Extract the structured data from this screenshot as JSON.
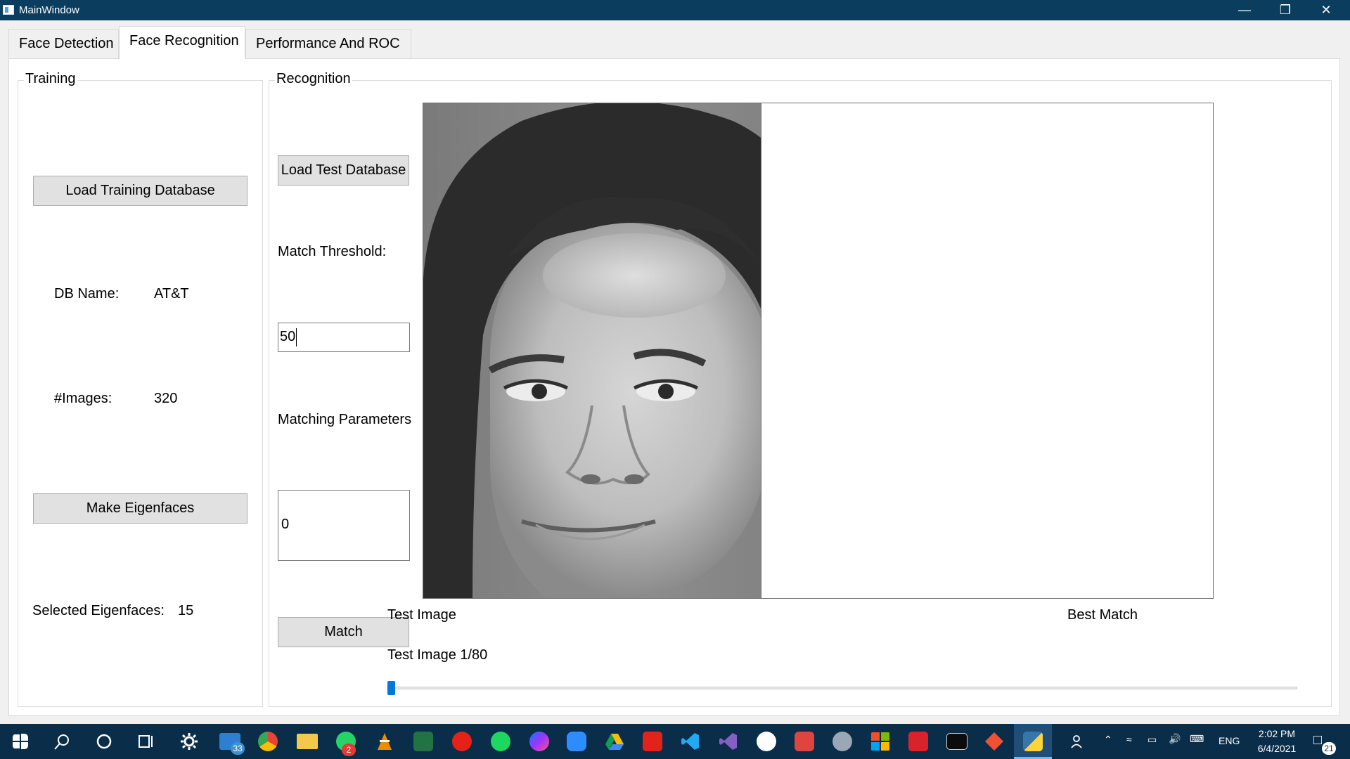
{
  "window": {
    "title": "MainWindow"
  },
  "tabs": [
    {
      "label": "Face Detection"
    },
    {
      "label": "Face Recognition"
    },
    {
      "label": "Performance And ROC"
    }
  ],
  "training": {
    "group_title": "Training",
    "load_button": "Load Training Database",
    "db_name_label": "DB Name:",
    "db_name_value": "AT&T",
    "images_label": "#Images:",
    "images_value": "320",
    "make_eigenfaces_button": "Make Eigenfaces",
    "selected_eigenfaces_label": "Selected Eigenfaces:",
    "selected_eigenfaces_value": "15"
  },
  "recognition": {
    "group_title": "Recognition",
    "load_test_button": "Load Test Database",
    "threshold_label": "Match Threshold:",
    "threshold_value": "50",
    "matching_parameters_label": "Matching Parameters",
    "matching_parameters_value": "0",
    "match_button": "Match",
    "test_image_caption": "Test Image",
    "best_match_caption": "Best Match",
    "test_image_counter": "Test Image 1/80",
    "slider_position": 0.0
  },
  "taskbar": {
    "mail_badge": "33",
    "whatsapp_badge": "2",
    "language": "ENG",
    "time": "2:02 PM",
    "date": "6/4/2021",
    "notifications_badge": "21"
  }
}
